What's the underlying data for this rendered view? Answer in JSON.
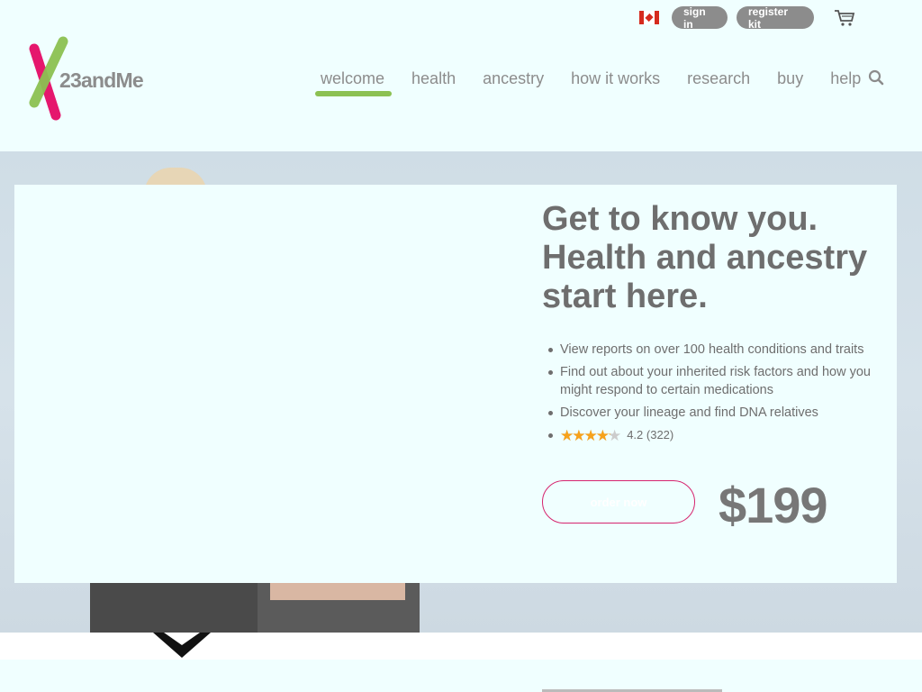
{
  "header": {
    "country_flag": "canada-flag-icon",
    "sign_in_label": "sign in",
    "register_kit_label": "register kit",
    "cart_icon": "cart-icon",
    "logo_text": "23andMe",
    "logo_colors": {
      "pink": "#e5176d",
      "green": "#8cc152"
    }
  },
  "nav": {
    "items": [
      {
        "label": "welcome",
        "active": true
      },
      {
        "label": "health"
      },
      {
        "label": "ancestry"
      },
      {
        "label": "how it works"
      },
      {
        "label": "research"
      },
      {
        "label": "buy"
      },
      {
        "label": "help"
      }
    ],
    "search_icon": "search-icon",
    "active_underline_color": "#8cc152"
  },
  "hero": {
    "headline": "Get to know you. Health and ancestry start here.",
    "features": [
      "View reports on over 100 health conditions and traits",
      "Find out about your inherited risk factors and how you might respond to certain medications",
      "Discover your lineage and find DNA relatives"
    ],
    "rating": {
      "value": 4.2,
      "max": 5,
      "text": "4.2 (322)",
      "star_color": "#f7a21b"
    },
    "order_button_label": "order now",
    "price": "$199",
    "button_border_color": "#d6246e"
  }
}
